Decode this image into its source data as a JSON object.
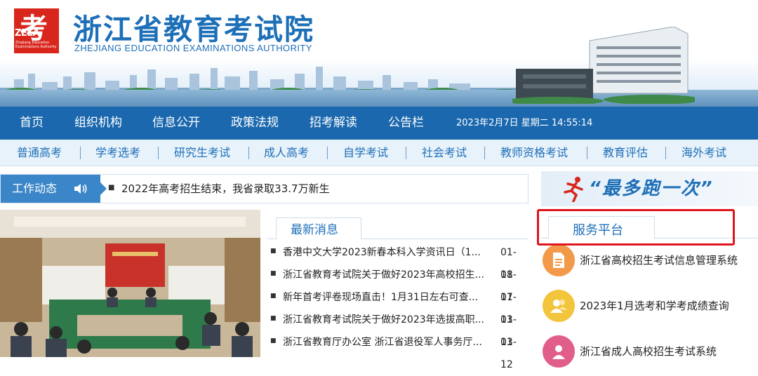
{
  "header": {
    "logo_char": "考",
    "logo_abbr": "ZEEA",
    "logo_sub": "Zhejiang Education Examinations Authority",
    "title": "浙江省教育考试院",
    "subtitle": "ZHEJIANG EDUCATION EXAMINATIONS AUTHORITY"
  },
  "main_nav": {
    "items": [
      "首页",
      "组织机构",
      "信息公开",
      "政策法规",
      "招考解读",
      "公告栏"
    ],
    "datetime": "2023年2月7日 星期二 14:55:14"
  },
  "sub_nav": {
    "items": [
      "普通高考",
      "学考选考",
      "研究生考试",
      "成人高考",
      "自学考试",
      "社会考试",
      "教师资格考试",
      "教育评估",
      "海外考试"
    ]
  },
  "ticker": {
    "label": "工作动态",
    "headline": "2022年高考招生结束，我省录取33.7万新生"
  },
  "latest": {
    "tab_label": "最新消息",
    "items": [
      {
        "title": "香港中文大学2023新春本科入学资讯日（1...",
        "date": "01-18"
      },
      {
        "title": "浙江省教育考试院关于做好2023年高校招生...",
        "date": "01-17"
      },
      {
        "title": "新年首考评卷现场直击！1月31日左右可查...",
        "date": "01-13"
      },
      {
        "title": "浙江省教育考试院关于做好2023年选拔高职...",
        "date": "01-13"
      },
      {
        "title": "浙江省教育厅办公室 浙江省退役军人事务厅...",
        "date": "01-12"
      }
    ]
  },
  "banner": {
    "text": "“最多跑一次”"
  },
  "service": {
    "tab_label": "服务平台",
    "items": [
      {
        "label": "浙江省高校招生考试信息管理系统",
        "icon": "document-icon",
        "color": "#f39a4a"
      },
      {
        "label": "2023年1月选考和学考成绩查询",
        "icon": "users-icon",
        "color": "#f2c53d"
      },
      {
        "label": "浙江省成人高校招生考试系统",
        "icon": "people-icon",
        "color": "#e25e8a"
      }
    ]
  },
  "colors": {
    "brand_blue": "#1b68ae",
    "logo_red": "#d8261c",
    "highlight_red": "#e0141c"
  }
}
